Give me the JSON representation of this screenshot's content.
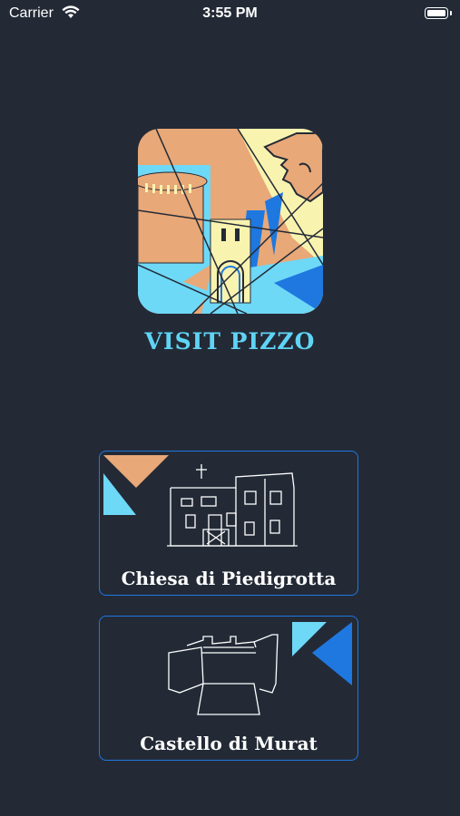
{
  "status_bar": {
    "carrier": "Carrier",
    "time": "3:55 PM"
  },
  "app": {
    "title": "VISIT PIZZO"
  },
  "cards": [
    {
      "label": "Chiesa di Piedigrotta",
      "icon": "church-illustration"
    },
    {
      "label": "Castello di Murat",
      "icon": "castle-illustration"
    }
  ],
  "colors": {
    "background": "#232a36",
    "accent_blue": "#1e78e0",
    "title_cyan": "#5fd4f5",
    "tan": "#e8a878",
    "light_cyan": "#6ed8f7",
    "pale_yellow": "#f9f3b0"
  }
}
